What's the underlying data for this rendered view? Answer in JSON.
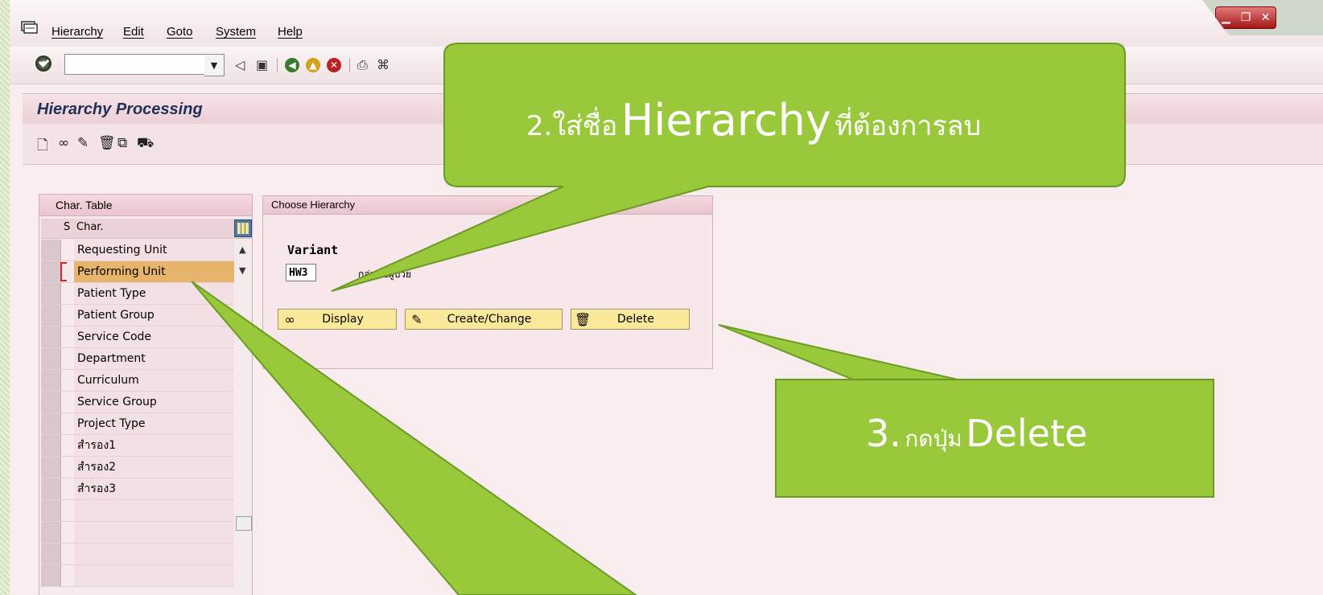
{
  "menu": {
    "items": [
      "Hierarchy",
      "Edit",
      "Goto",
      "System",
      "Help"
    ]
  },
  "toolbar": {
    "command_value": ""
  },
  "page": {
    "title": "Hierarchy Processing"
  },
  "char_table": {
    "title": "Char. Table",
    "col_s": "S",
    "col_char": "Char.",
    "rows": [
      "Requesting Unit",
      "Performing Unit",
      "Patient Type",
      "Patient Group",
      "Service Code",
      "Department",
      "Curriculum",
      "Service Group",
      "Project Type",
      "สำรอง1",
      "สำรอง2",
      "สำรอง3",
      "",
      "",
      "",
      ""
    ],
    "selected_index": 1
  },
  "choose": {
    "title": "Choose Hierarchy",
    "variant_label": "Variant",
    "variant_value": "HW3",
    "variant_desc": "กลุ่มหอผู้ป่วย",
    "buttons": {
      "display": "Display",
      "create_change": "Create/Change",
      "delete": "Delete"
    }
  },
  "callouts": {
    "step2_prefix": "2.ใส่ชื่อ",
    "step2_big": "Hierarchy",
    "step2_suffix": "ที่ต้องการลบ",
    "step3_prefix": "3.",
    "step3_mid": "กดปุ่ม",
    "step3_big": "Delete"
  },
  "colors": {
    "callout_green": "#99c83a",
    "callout_border": "#6b9a25",
    "selected_row": "#e6b46b",
    "title_text": "#1f2f57",
    "button_yellow": "#fbe99b"
  }
}
